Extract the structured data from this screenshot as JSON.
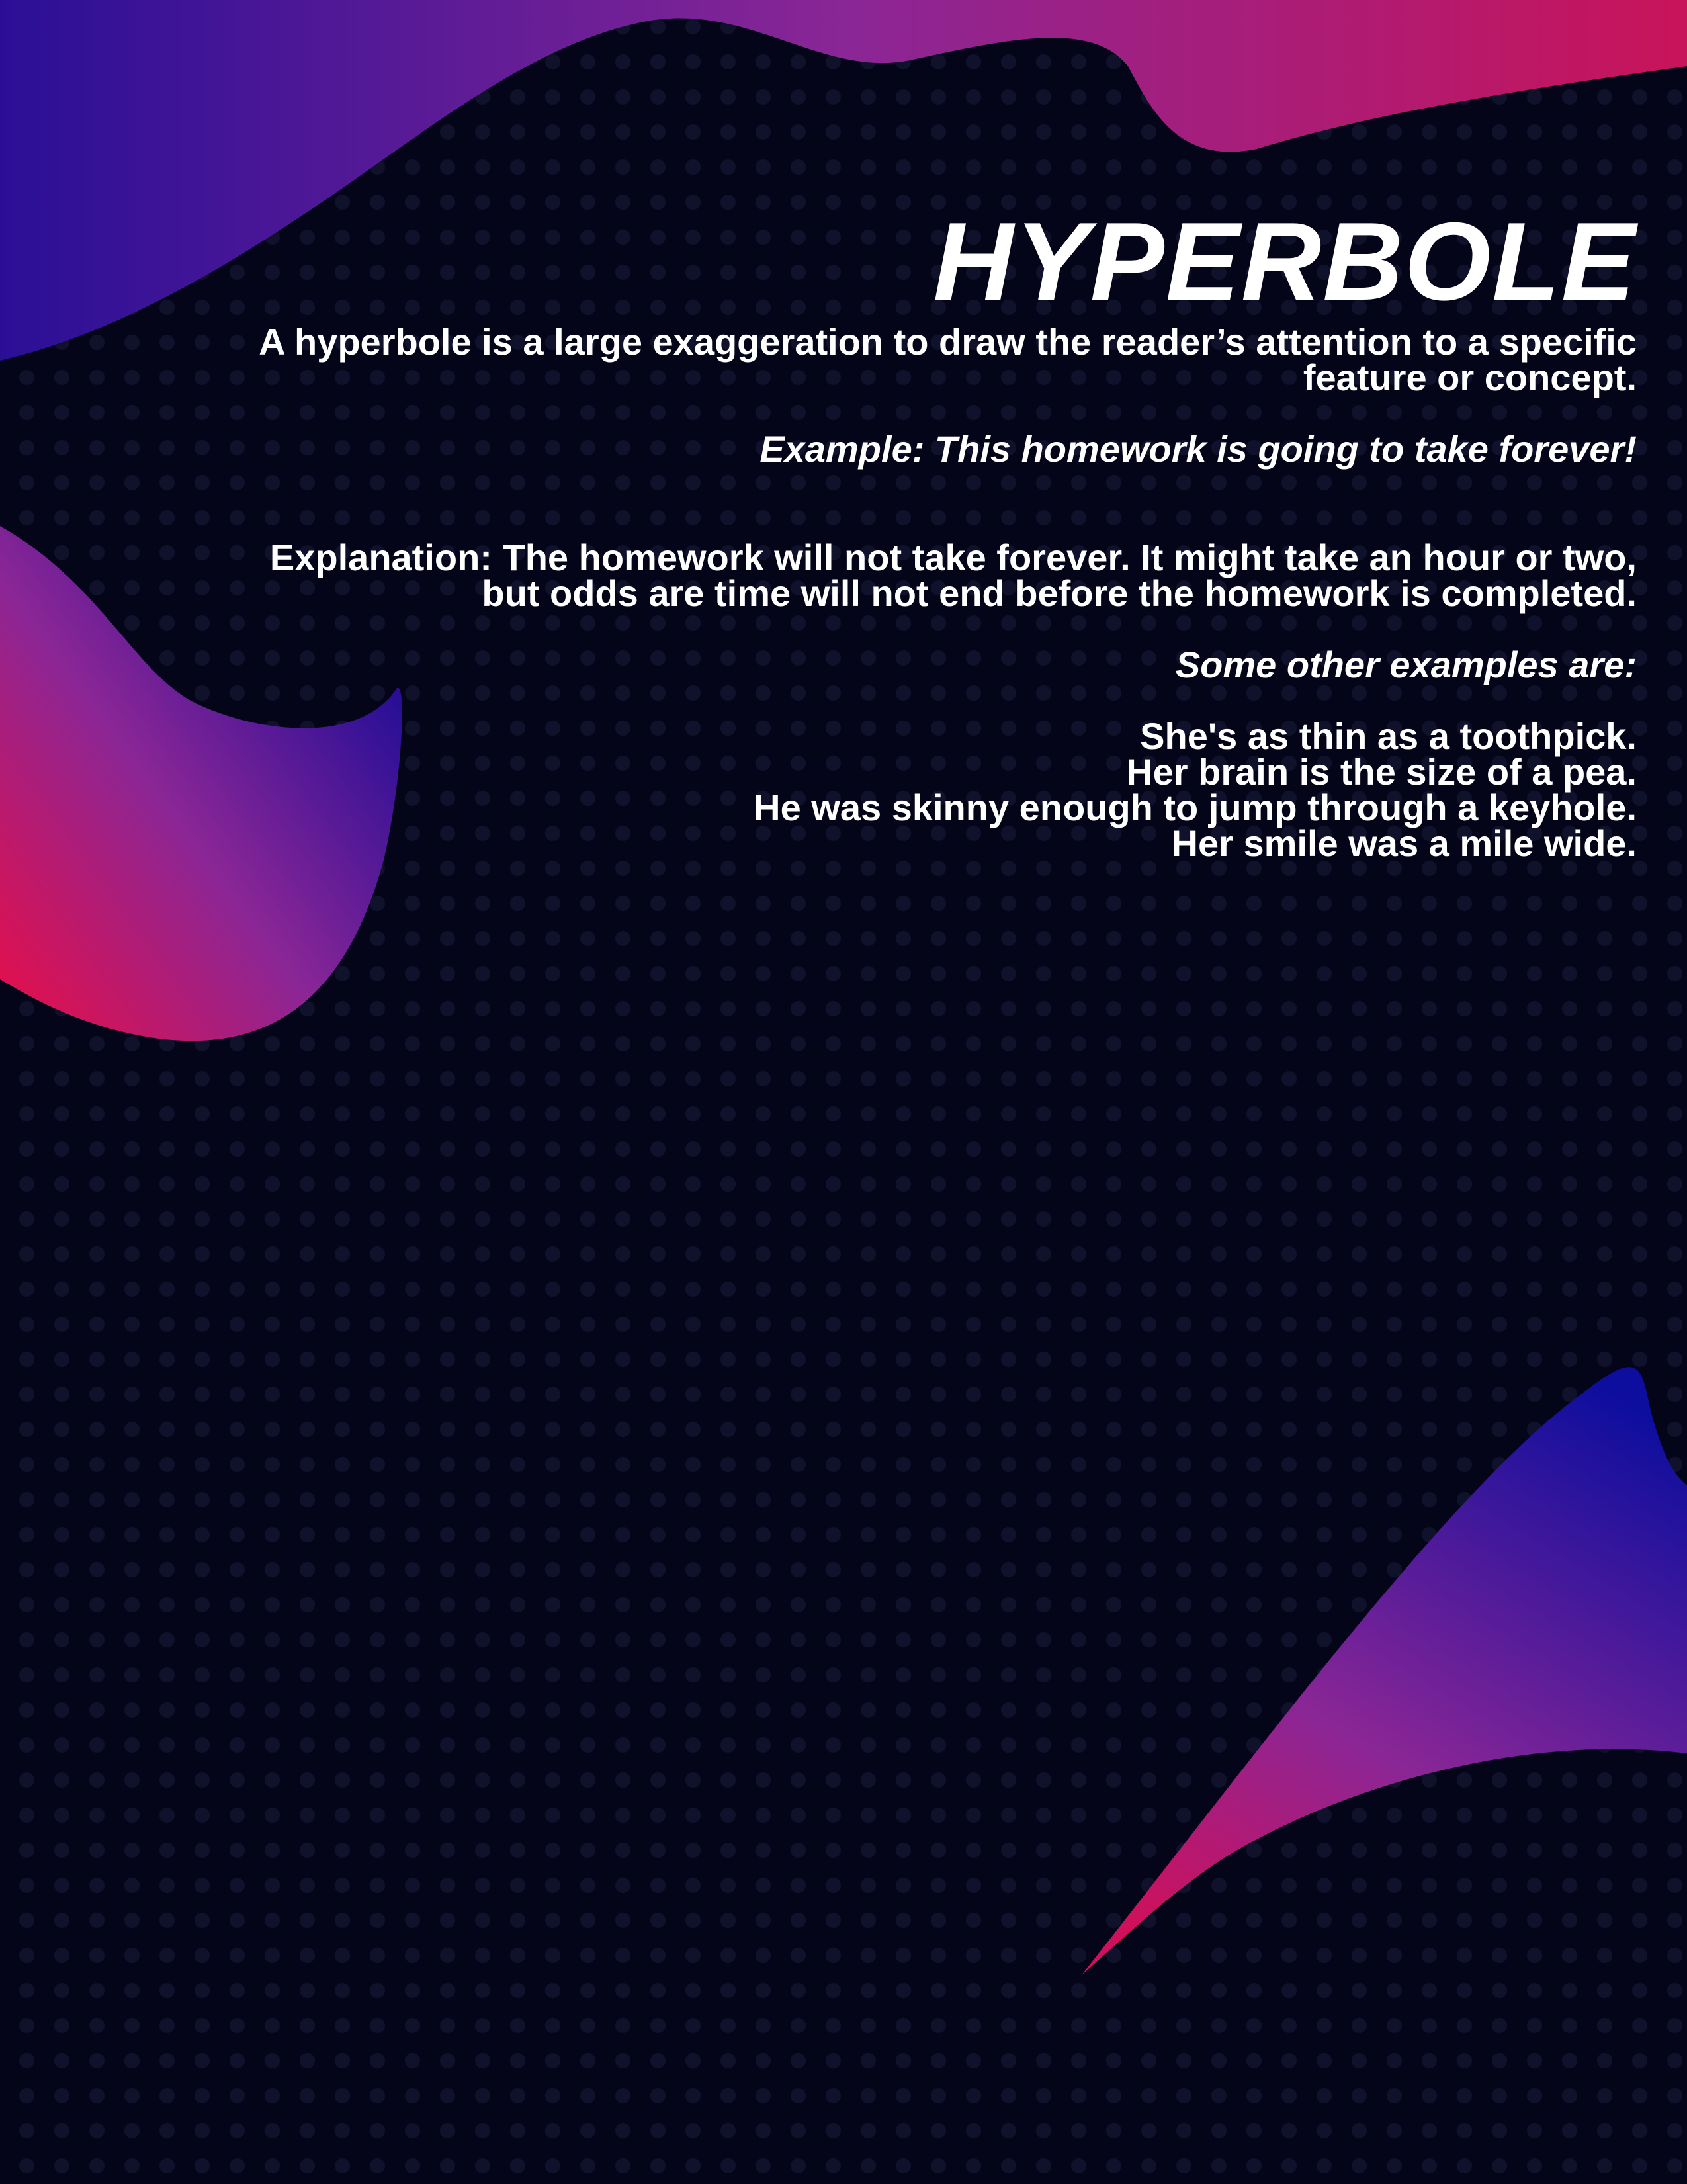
{
  "title": "HYPERBOLE",
  "definition": [
    "A hyperbole is a large exaggeration to draw the reader’s attention to a specific",
    "feature or concept."
  ],
  "example": "Example: This homework is going to take forever!",
  "explanation": [
    "Explanation: The homework will not take forever.  It might take an hour or two,",
    "but odds are time will not end before the homework is completed."
  ],
  "other_examples_heading": "Some other examples are:",
  "other_examples": [
    "She's as thin as a toothpick.",
    "Her brain is the size of a pea.",
    "He was skinny enough to jump through a keyhole.",
    "Her smile was a mile wide."
  ],
  "colors": {
    "background": "#050519",
    "blue": "#2a0f96",
    "purple": "#8a2696",
    "magenta": "#c8145a",
    "text": "#ffffff"
  }
}
